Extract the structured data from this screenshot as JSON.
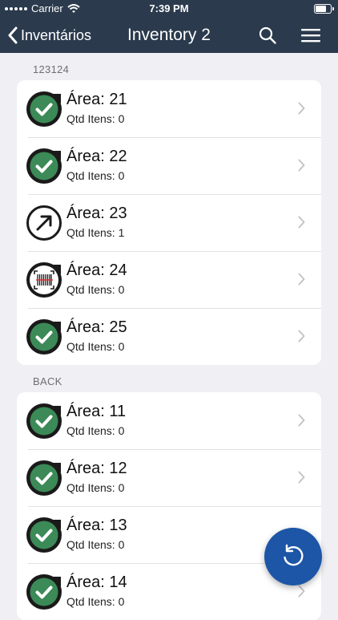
{
  "status_bar": {
    "carrier": "Carrier",
    "time": "7:39 PM"
  },
  "nav": {
    "back_label": "Inventários",
    "title": "Inventory 2",
    "search_icon": "search-icon",
    "menu_icon": "menu-icon"
  },
  "colors": {
    "header_bg": "#2b3a4d",
    "check_green": "#3b8a57",
    "fab_blue": "#1d56a6",
    "background": "#efeff4"
  },
  "sections": [
    {
      "header": "123124",
      "rows": [
        {
          "title": "Área: 21",
          "subtitle": "Qtd Itens: 0",
          "status": "check"
        },
        {
          "title": "Área: 22",
          "subtitle": "Qtd Itens: 0",
          "status": "check"
        },
        {
          "title": "Área: 23",
          "subtitle": "Qtd Itens: 1",
          "status": "arrow"
        },
        {
          "title": "Área: 24",
          "subtitle": "Qtd Itens: 0",
          "status": "barcode"
        },
        {
          "title": "Área: 25",
          "subtitle": "Qtd Itens: 0",
          "status": "check"
        }
      ]
    },
    {
      "header": "BACK",
      "rows": [
        {
          "title": "Área: 11",
          "subtitle": "Qtd Itens: 0",
          "status": "check"
        },
        {
          "title": "Área: 12",
          "subtitle": "Qtd Itens: 0",
          "status": "check"
        },
        {
          "title": "Área: 13",
          "subtitle": "Qtd Itens: 0",
          "status": "check"
        },
        {
          "title": "Área: 14",
          "subtitle": "Qtd Itens: 0",
          "status": "check"
        }
      ]
    }
  ],
  "fab": {
    "icon": "refresh-icon"
  }
}
